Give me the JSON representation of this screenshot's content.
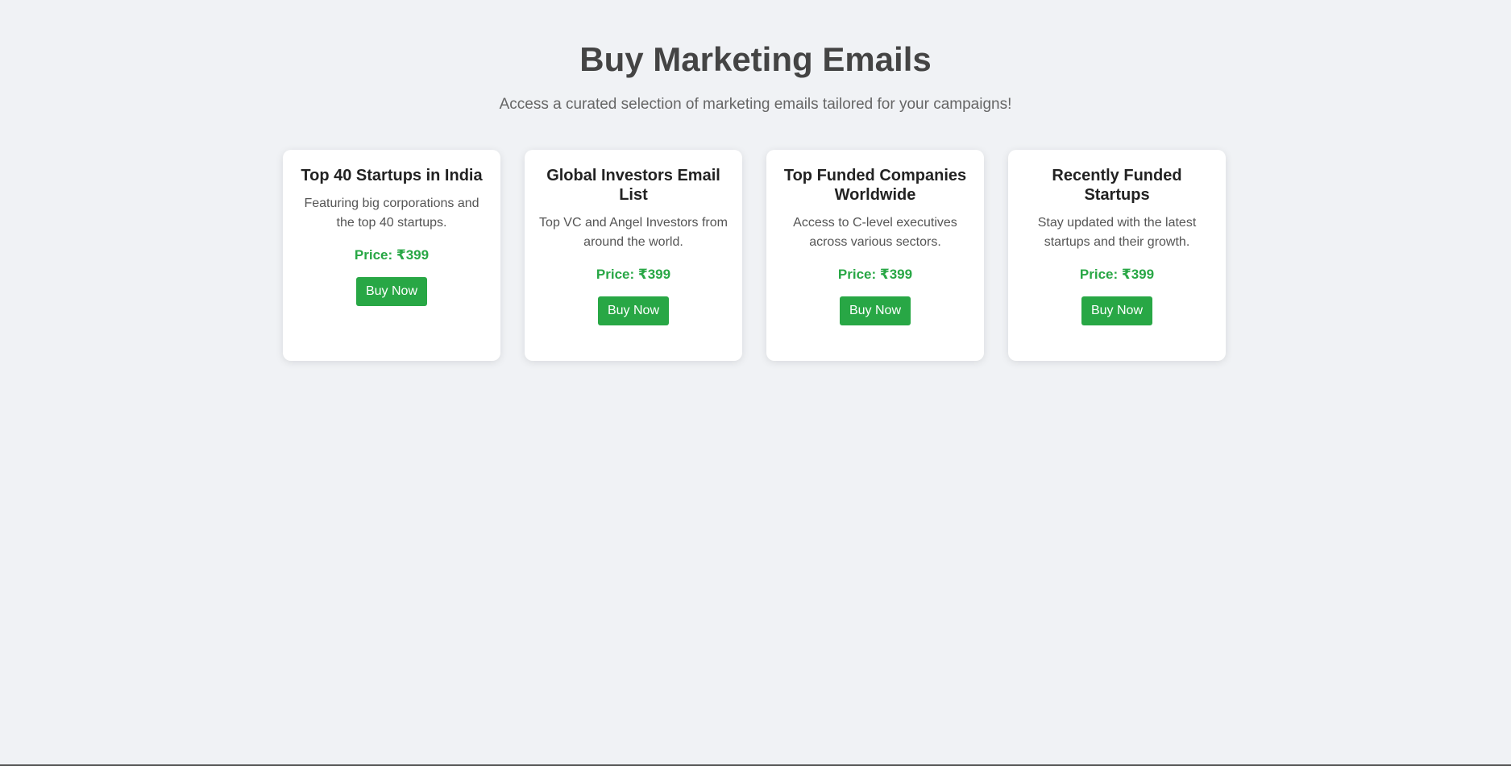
{
  "header": {
    "title": "Buy Marketing Emails",
    "subtitle": "Access a curated selection of marketing emails tailored for your campaigns!"
  },
  "colors": {
    "background": "#f0f2f5",
    "accent_green": "#28a745",
    "title_text": "#444444"
  },
  "cards": [
    {
      "title": "Top 40 Startups in India",
      "description": "Featuring big corporations and the top 40 startups.",
      "price": "Price: ₹399",
      "button_label": "Buy Now"
    },
    {
      "title": "Global Investors Email List",
      "description": "Top VC and Angel Investors from around the world.",
      "price": "Price: ₹399",
      "button_label": "Buy Now"
    },
    {
      "title": "Top Funded Companies Worldwide",
      "description": "Access to C-level executives across various sectors.",
      "price": "Price: ₹399",
      "button_label": "Buy Now"
    },
    {
      "title": "Recently Funded Startups",
      "description": "Stay updated with the latest startups and their growth.",
      "price": "Price: ₹399",
      "button_label": "Buy Now"
    }
  ]
}
